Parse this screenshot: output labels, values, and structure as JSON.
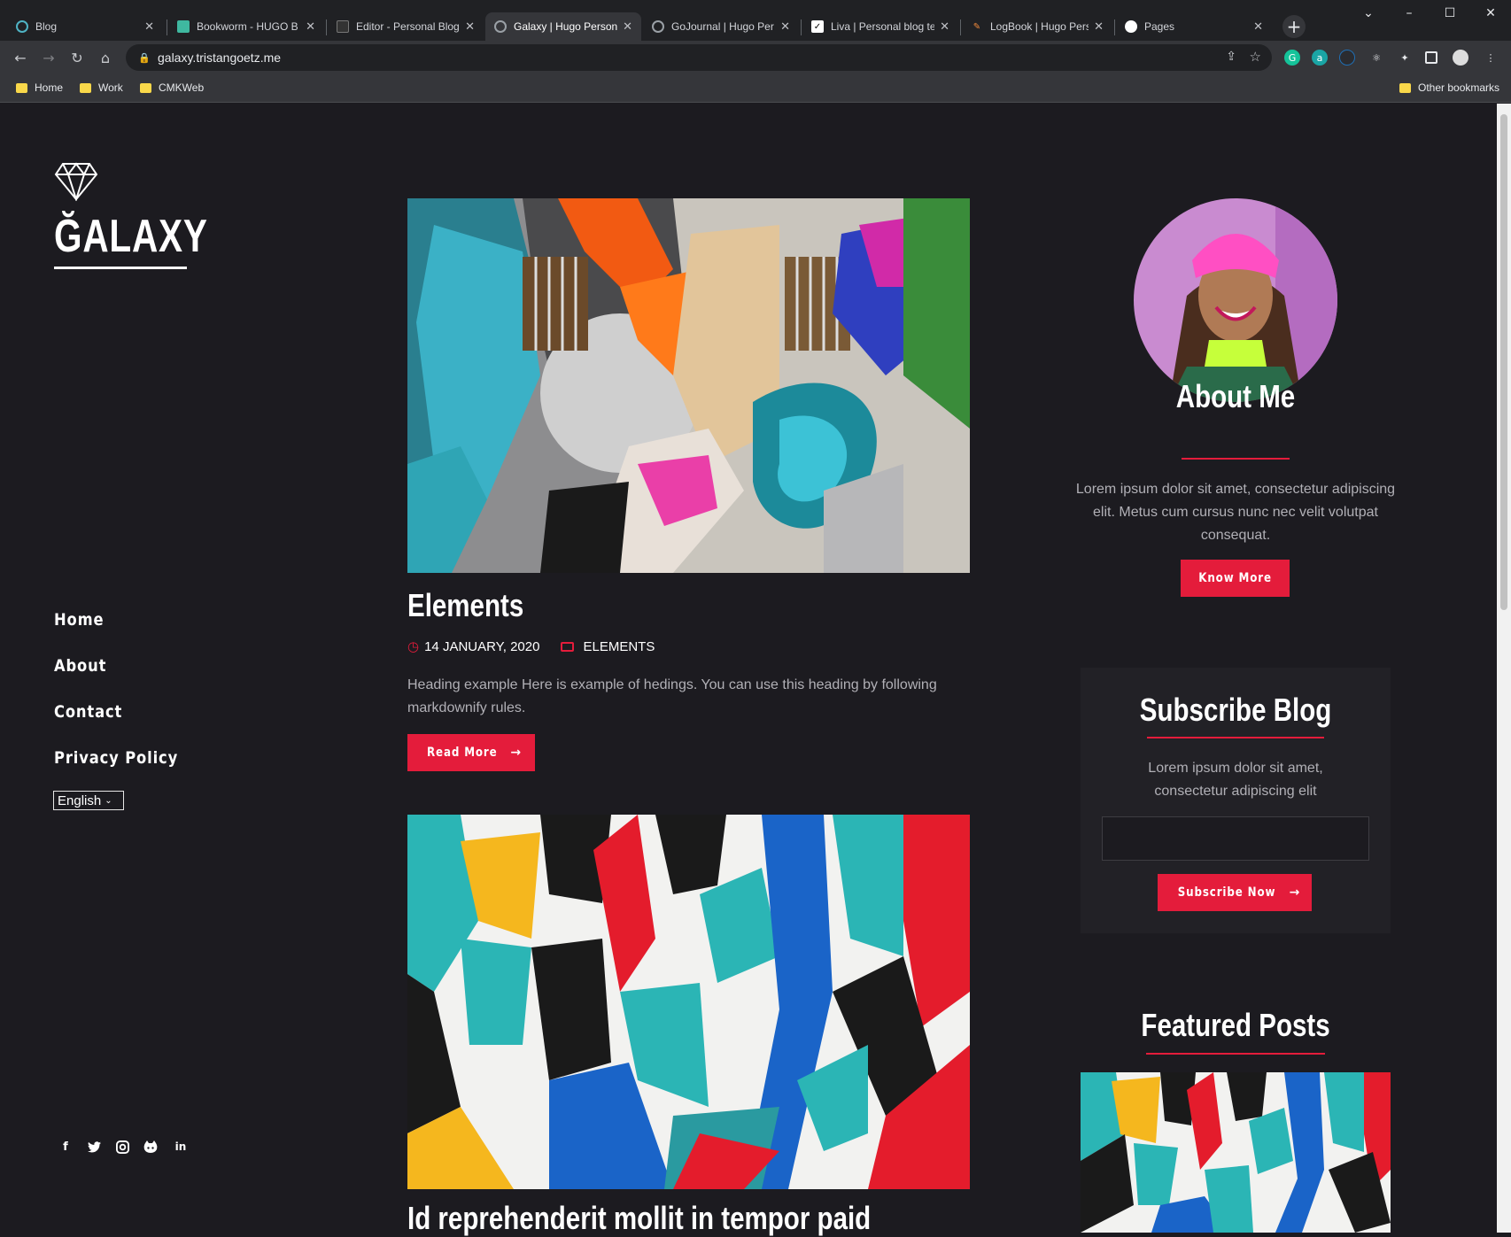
{
  "browser": {
    "tabs": [
      {
        "title": "Blog",
        "active": false
      },
      {
        "title": "Bookworm - HUGO B",
        "active": false
      },
      {
        "title": "Editor - Personal Blog",
        "active": false
      },
      {
        "title": "Galaxy | Hugo Person",
        "active": true
      },
      {
        "title": "GoJournal | Hugo Per",
        "active": false
      },
      {
        "title": "Liva | Personal blog te",
        "active": false
      },
      {
        "title": "LogBook | Hugo Pers",
        "active": false
      },
      {
        "title": "Pages",
        "active": false
      }
    ],
    "url": "galaxy.tristangoetz.me",
    "bookmarks": [
      "Home",
      "Work",
      "CMKWeb"
    ],
    "other_bookmarks": "Other bookmarks"
  },
  "site": {
    "logo": "ĞALAXY",
    "menu": [
      "Home",
      "About",
      "Contact",
      "Privacy Policy"
    ],
    "language": "English",
    "social_icons": [
      "facebook-icon",
      "twitter-icon",
      "instagram-icon",
      "github-icon",
      "linkedin-icon"
    ]
  },
  "posts": [
    {
      "title": "Elements",
      "date": "14 JANUARY, 2020",
      "category": "ELEMENTS",
      "excerpt": "Heading example Here is example of hedings. You can use this heading by following markdownify rules.",
      "button": "Read More"
    },
    {
      "title": "Id reprehenderit mollit in tempor paid"
    }
  ],
  "sidebar": {
    "about_title": "About Me",
    "about_text": "Lorem ipsum dolor sit amet, consectetur adipiscing elit. Metus cum cursus nunc nec velit volutpat consequat.",
    "about_button": "Know More",
    "subscribe_title": "Subscribe Blog",
    "subscribe_text": "Lorem ipsum dolor sit amet, consectetur adipiscing elit",
    "subscribe_button": "Subscribe Now",
    "featured_title": "Featured Posts"
  },
  "colors": {
    "accent": "#e41c3b",
    "background": "#1c1b20",
    "card": "#222126"
  }
}
